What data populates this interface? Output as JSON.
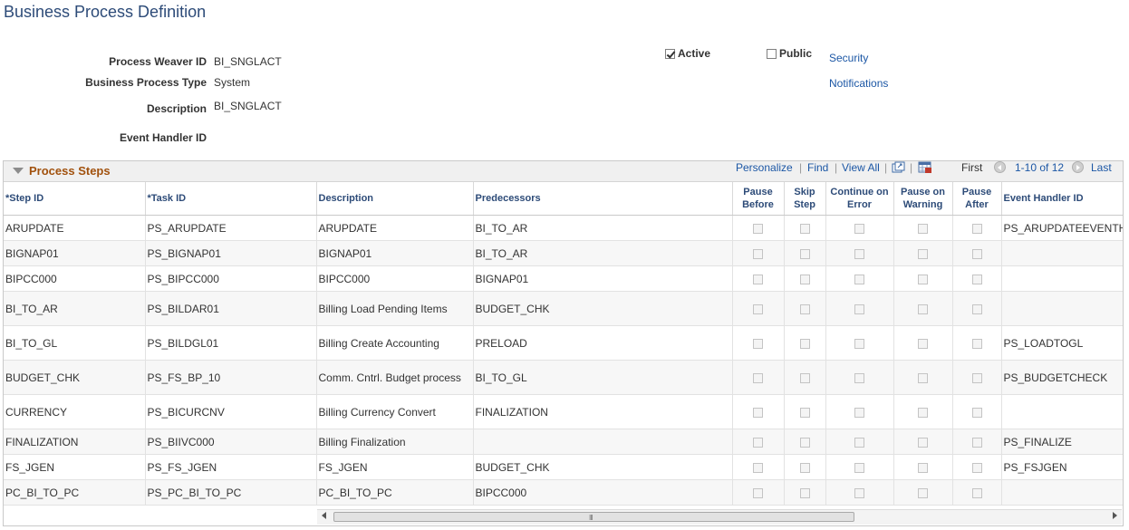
{
  "page": {
    "title": "Business Process Definition"
  },
  "form": {
    "process_weaver_id": {
      "label": "Process Weaver ID",
      "value": "BI_SNGLACT"
    },
    "business_process_type": {
      "label": "Business Process Type",
      "value": "System"
    },
    "description": {
      "label": "Description",
      "value": "BI_SNGLACT"
    },
    "event_handler_id": {
      "label": "Event Handler ID",
      "value": ""
    },
    "active": {
      "label": "Active",
      "checked": true
    },
    "public": {
      "label": "Public",
      "checked": false
    },
    "links": {
      "security": "Security",
      "notifications": "Notifications"
    }
  },
  "grid": {
    "title": "Process Steps",
    "toolbar": {
      "personalize": "Personalize",
      "find": "Find",
      "view_all": "View All",
      "first": "First",
      "range": "1-10 of 12",
      "last": "Last",
      "separator": "|"
    },
    "columns": {
      "step_id": "*Step ID",
      "task_id": "*Task ID",
      "description": "Description",
      "predecessors": "Predecessors",
      "pause_before": "Pause Before",
      "skip_step": "Skip Step",
      "continue_on_error": "Continue on Error",
      "pause_on_warning": "Pause on Warning",
      "pause_after": "Pause After",
      "event_handler_id": "Event Handler ID"
    },
    "rows": [
      {
        "step_id": "ARUPDATE",
        "task_id": "PS_ARUPDATE",
        "description": "ARUPDATE",
        "predecessors": "BI_TO_AR",
        "event_handler_id": "PS_ARUPDATEEVENTH"
      },
      {
        "step_id": "BIGNAP01",
        "task_id": "PS_BIGNAP01",
        "description": "BIGNAP01",
        "predecessors": "BI_TO_AR",
        "event_handler_id": ""
      },
      {
        "step_id": "BIPCC000",
        "task_id": "PS_BIPCC000",
        "description": "BIPCC000",
        "predecessors": "BIGNAP01",
        "event_handler_id": ""
      },
      {
        "step_id": "BI_TO_AR",
        "task_id": "PS_BILDAR01",
        "description": "Billing Load Pending Items",
        "predecessors": "BUDGET_CHK",
        "event_handler_id": ""
      },
      {
        "step_id": "BI_TO_GL",
        "task_id": "PS_BILDGL01",
        "description": "Billing Create Accounting",
        "predecessors": "PRELOAD",
        "event_handler_id": "PS_LOADTOGL"
      },
      {
        "step_id": "BUDGET_CHK",
        "task_id": "PS_FS_BP_10",
        "description": "Comm. Cntrl. Budget process",
        "predecessors": "BI_TO_GL",
        "event_handler_id": "PS_BUDGETCHECK"
      },
      {
        "step_id": "CURRENCY",
        "task_id": "PS_BICURCNV",
        "description": "Billing Currency Convert",
        "predecessors": "FINALIZATION",
        "event_handler_id": ""
      },
      {
        "step_id": "FINALIZATION",
        "task_id": "PS_BIIVC000",
        "description": "Billing Finalization",
        "predecessors": "",
        "event_handler_id": "PS_FINALIZE"
      },
      {
        "step_id": "FS_JGEN",
        "task_id": "PS_FS_JGEN",
        "description": "FS_JGEN",
        "predecessors": "BUDGET_CHK",
        "event_handler_id": "PS_FSJGEN"
      },
      {
        "step_id": "PC_BI_TO_PC",
        "task_id": "PS_PC_BI_TO_PC",
        "description": "PC_BI_TO_PC",
        "predecessors": "BIPCC000",
        "event_handler_id": ""
      }
    ],
    "scrollbar_grip": "III"
  }
}
